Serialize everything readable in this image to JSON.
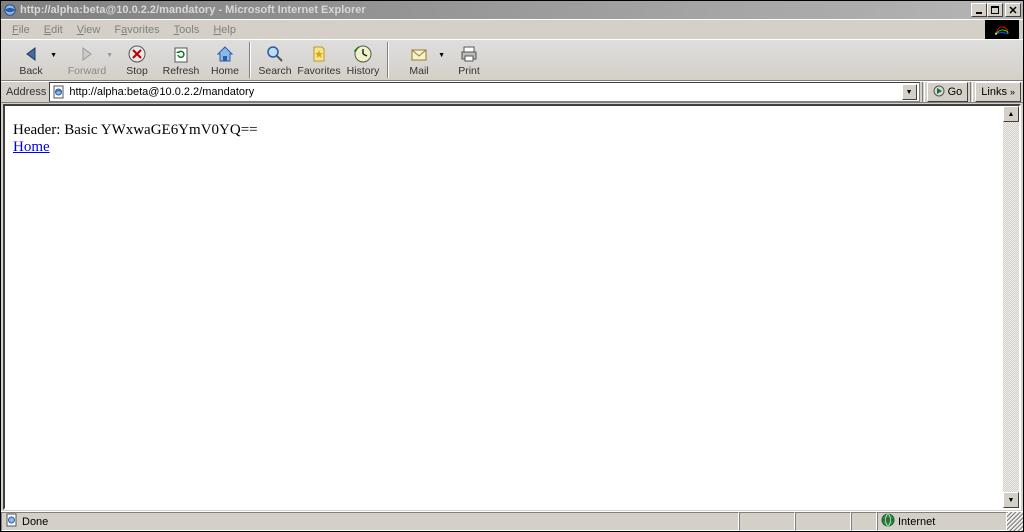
{
  "title": "http://alpha:beta@10.0.2.2/mandatory - Microsoft Internet Explorer",
  "menu": {
    "file": "File",
    "edit": "Edit",
    "view": "View",
    "favorites": "Favorites",
    "tools": "Tools",
    "help": "Help"
  },
  "toolbar": {
    "back": "Back",
    "forward": "Forward",
    "stop": "Stop",
    "refresh": "Refresh",
    "home": "Home",
    "search": "Search",
    "favorites": "Favorites",
    "history": "History",
    "mail": "Mail",
    "print": "Print"
  },
  "address": {
    "label": "Address",
    "url": "http://alpha:beta@10.0.2.2/mandatory",
    "go": "Go",
    "links": "Links"
  },
  "page": {
    "header_line": "Header: Basic YWxwaGE6YmV0YQ==",
    "home_link": "Home"
  },
  "status": {
    "done": "Done",
    "zone": "Internet"
  }
}
